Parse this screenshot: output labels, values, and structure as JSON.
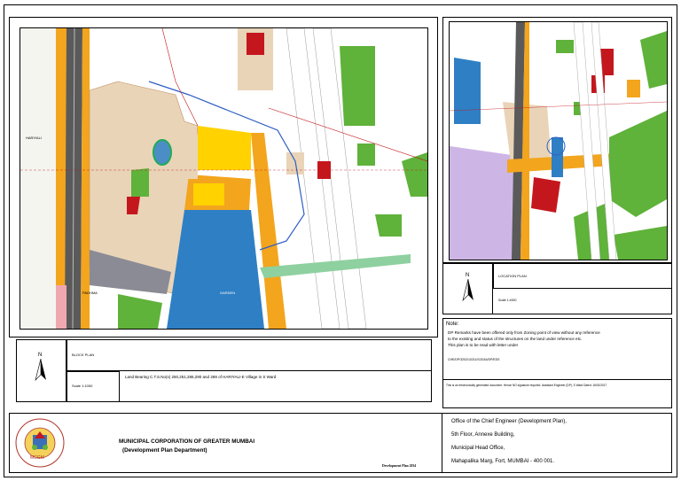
{
  "block_plan": {
    "title": "BLOCK PLAN",
    "north": "N",
    "scale": "Scale 1:1000",
    "land_description": "Land Bearing C.T.S.No(s) 250,251,286,290 and 289 of HARIYALI-E Village in S Ward"
  },
  "location_plan": {
    "title": "LOCATION PLAN",
    "north": "N",
    "scale": "Scale 1:4000"
  },
  "note": {
    "heading": "Note:",
    "lines": [
      "DP Remarks have been offered only from Zoning point of view without any reference",
      "to the existing and status of the structures on the land under reference etc.",
      "This plan is to be read with letter under"
    ],
    "reference": "CHE/DP/3202/10211/S/2016/DP/EDS",
    "disclaimer": "This is an electronically generated document. Hence NO signature required. Assistant Engineer (DP), S Ward Dated: 16/02/2017"
  },
  "footer": {
    "org_name": "MUNICIPAL CORPORATION OF GREATER MUMBAI",
    "dept": "(Development Plan Department)",
    "plan_label": "Development Plan 2034",
    "seal_text": "Municipal Corporation of Greater Mumbai",
    "address": [
      "Office of the Chief Engineer (Development Plan),",
      "5th Floor, Annexe Building,",
      "Municipal Head Office,",
      "Mahapalika Marg, Fort, MUMBAI - 400 001."
    ]
  },
  "map_labels": {
    "road_label_1": "HARIYALI",
    "road_label_2": "PADHMA",
    "zone_label": "GARDEN"
  },
  "colors": {
    "residential": "#e9d4b8",
    "commercial": "#f3a51d",
    "garden": "#5fb23a",
    "public": "#2f7fc4",
    "industrial": "#8b8b95",
    "road": "#ffffff",
    "railway": "#555555",
    "special": "#c4171d",
    "purple_zone": "#cdb6e6",
    "pink_zone": "#f0a8b0"
  }
}
